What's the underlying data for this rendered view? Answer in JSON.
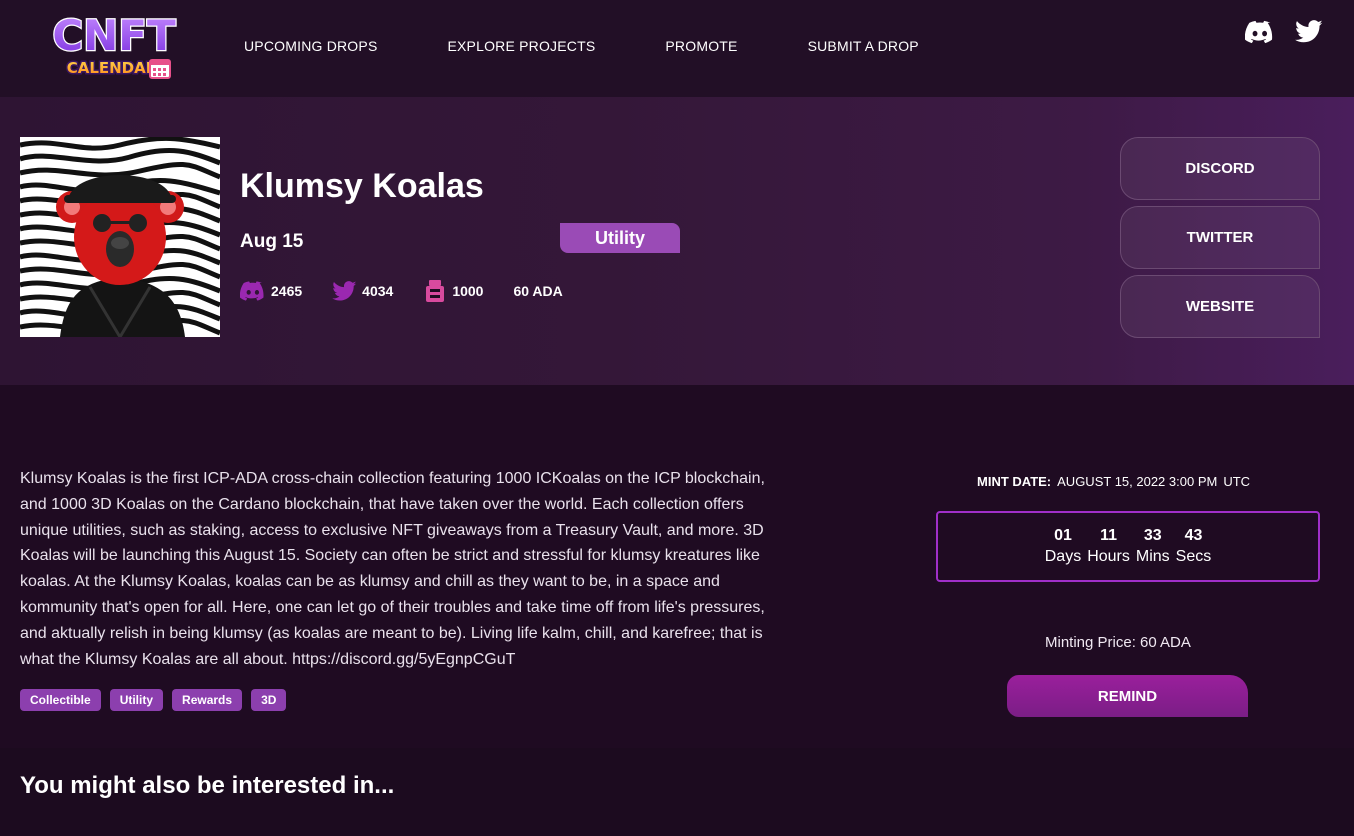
{
  "brand": {
    "logo_top": "CNFT",
    "logo_bottom": "CALENDAR"
  },
  "nav": {
    "links": [
      "UPCOMING DROPS",
      "EXPLORE PROJECTS",
      "PROMOTE",
      "SUBMIT A DROP"
    ]
  },
  "icons": {
    "discord": "discord-icon",
    "twitter": "twitter-icon",
    "supply": "nft-supply-icon"
  },
  "project": {
    "name": "Klumsy Koalas",
    "date": "Aug 15",
    "category": "Utility",
    "stats": {
      "discord": "2465",
      "twitter": "4034",
      "supply": "1000",
      "price": "60 ADA"
    },
    "buttons": [
      "DISCORD",
      "TWITTER",
      "WEBSITE"
    ],
    "description": "Klumsy Koalas is the first ICP-ADA cross-chain collection featuring 1000 ICKoalas on the ICP blockchain, and 1000 3D Koalas on the Cardano blockchain, that have taken over the world. Each collection offers unique utilities, such as staking, access to exclusive NFT giveaways from a Treasury Vault, and more. 3D Koalas will be launching this August 15. Society can often be strict and stressful for klumsy kreatures like koalas. At the Klumsy Koalas, koalas can be as klumsy and chill as they want to be, in a space and kommunity that's open for all. Here, one can let go of their troubles and take time off from life's pressures, and aktually relish in being klumsy (as koalas are meant to be). Living life kalm, chill, and karefree; that is what the Klumsy Koalas are all about. https://discord.gg/5yEgnpCGuT",
    "tags": [
      "Collectible",
      "Utility",
      "Rewards",
      "3D"
    ]
  },
  "mint": {
    "label": "MINT DATE:",
    "date": "AUGUST 15, 2022 3:00 PM",
    "tz": "UTC",
    "countdown": [
      {
        "value": "01",
        "label": "Days"
      },
      {
        "value": "11",
        "label": "Hours"
      },
      {
        "value": "33",
        "label": "Mins"
      },
      {
        "value": "43",
        "label": "Secs"
      }
    ],
    "price_text": "Minting Price: 60 ADA",
    "remind_label": "REMIND"
  },
  "related": {
    "heading": "You might also be interested in..."
  },
  "colors": {
    "accent": "#9a4bb6",
    "countdown_border": "#a02fc9",
    "remind": "#8b1f92",
    "background": "#1c0b1f"
  }
}
